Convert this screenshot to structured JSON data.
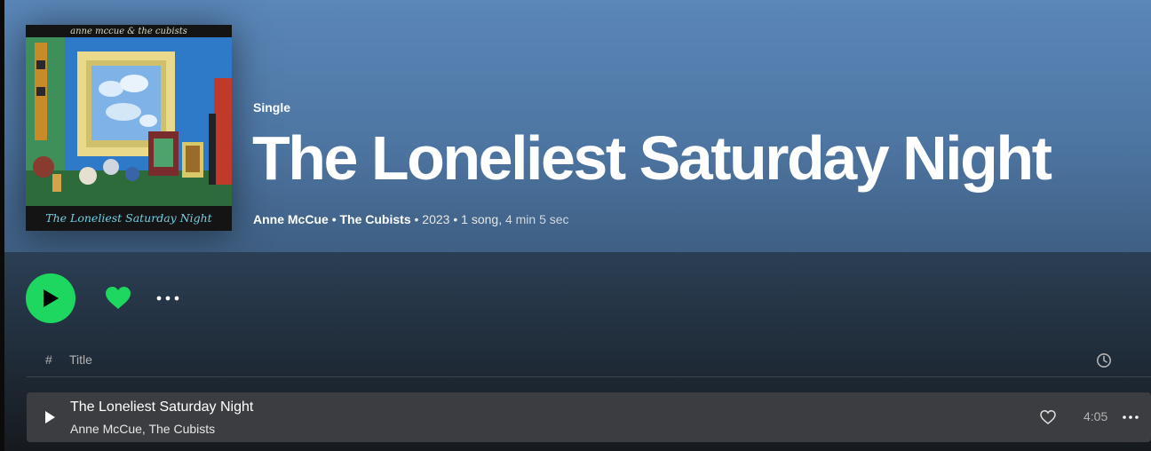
{
  "album": {
    "type_label": "Single",
    "title": "The Loneliest Saturday Night",
    "artists": [
      "Anne McCue",
      "The Cubists"
    ],
    "year": "2023",
    "song_count": "1 song",
    "duration": "4 min 5 sec",
    "cover_top_text": "anne mccue & the cubists",
    "cover_bottom_text": "The Loneliest Saturday Night"
  },
  "controls": {
    "play_icon": "play-icon",
    "like_icon": "heart-filled-icon",
    "more_icon": "more-horizontal-icon",
    "accent_color": "#1ed760"
  },
  "tracklist": {
    "headers": {
      "number": "#",
      "title": "Title",
      "duration_icon": "clock-icon"
    },
    "rows": [
      {
        "title": "The Loneliest Saturday Night",
        "artists": "Anne McCue, The Cubists",
        "duration": "4:05"
      }
    ]
  }
}
